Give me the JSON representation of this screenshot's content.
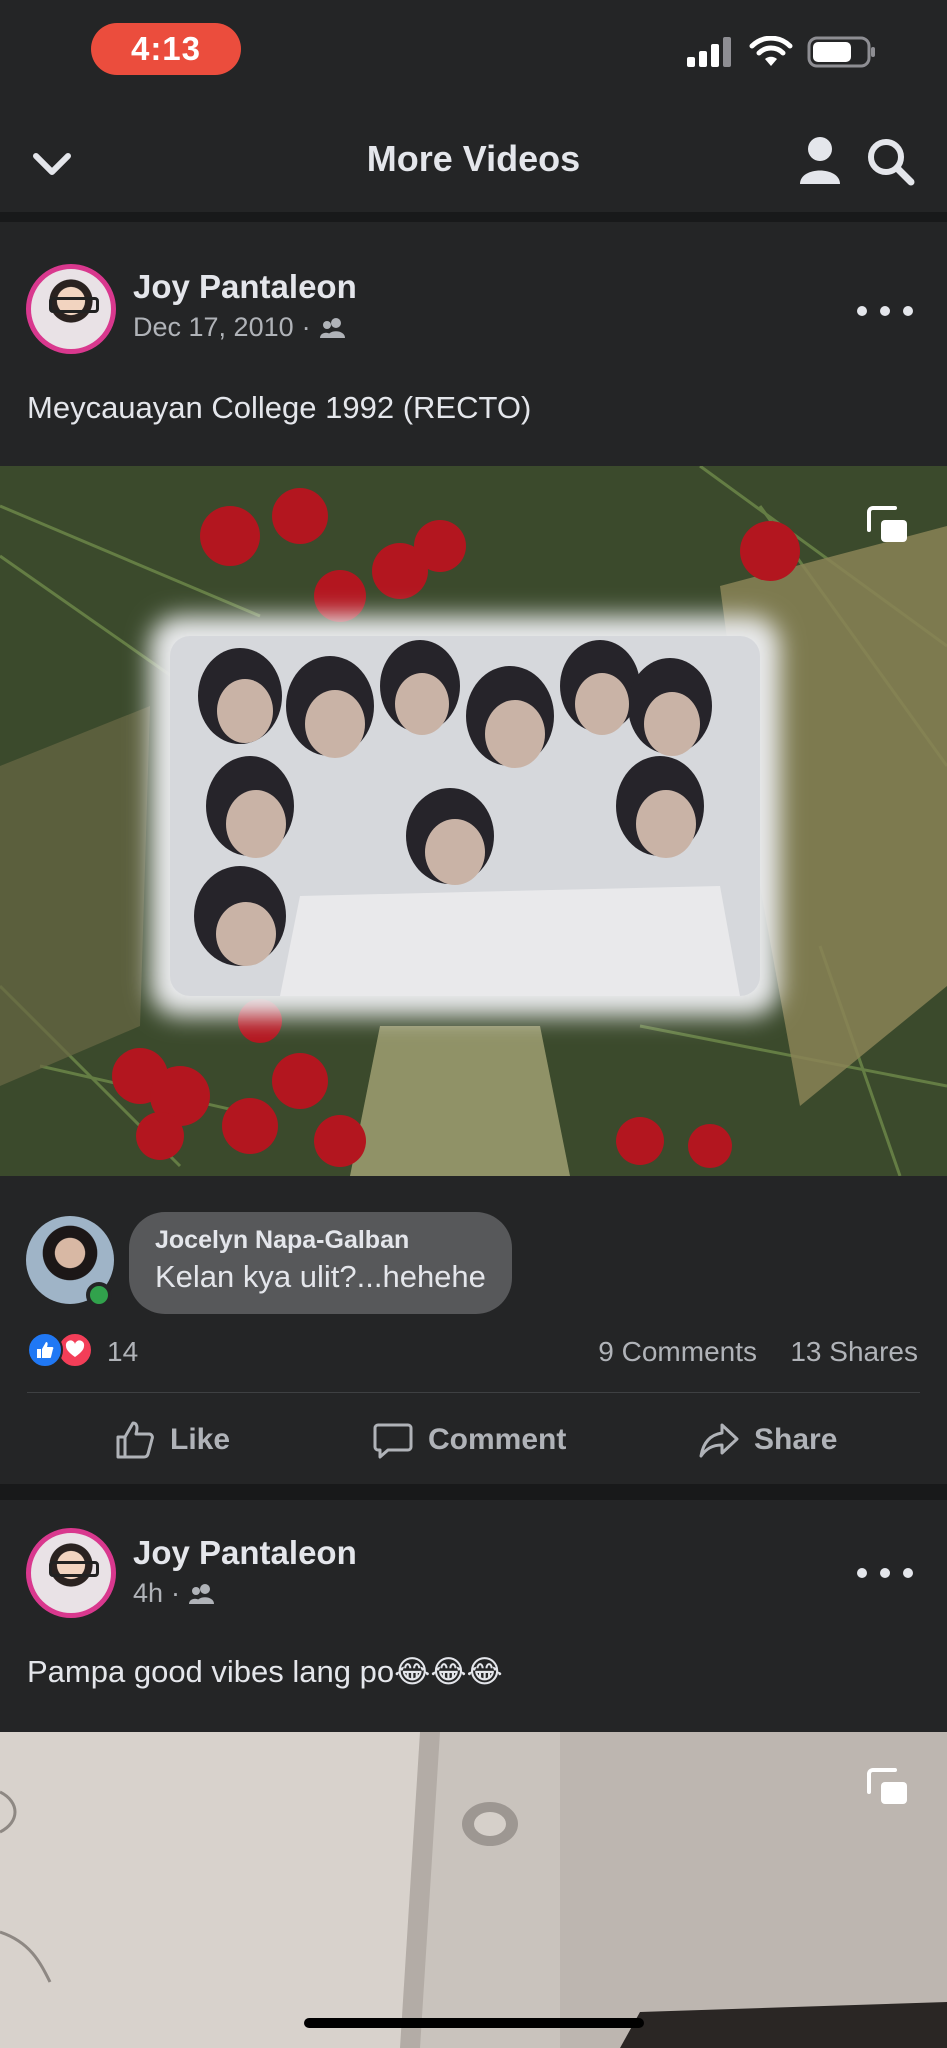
{
  "status_bar": {
    "time": "4:13"
  },
  "nav": {
    "title": "More Videos"
  },
  "posts": [
    {
      "author": "Joy Pantaleon",
      "date": "Dec 17, 2010",
      "text": "Meycauayan College 1992 (RECTO)",
      "comment": {
        "name": "Jocelyn Napa-Galban",
        "text": "Kelan kya ulit?...hehehe"
      },
      "reactions": "14",
      "comments": "9 Comments",
      "shares": "13 Shares"
    },
    {
      "author": "Joy Pantaleon",
      "date": "4h",
      "text": "Pampa good vibes lang po😂😂😂"
    }
  ],
  "actions": {
    "like": "Like",
    "comment": "Comment",
    "share": "Share"
  },
  "icons": {
    "back": "chevron-down-icon",
    "profile": "person-icon",
    "search": "search-icon",
    "audience": "friends-icon",
    "pip": "picture-in-picture-icon",
    "more": "more-dots-icon"
  },
  "colors": {
    "background": "#242526",
    "separator": "#18191a",
    "time_pill": "#eb4d3d",
    "avatar_ring": "#d9388e",
    "like_blue": "#2078f4",
    "love_red": "#f33e58",
    "online_green": "#31a24c"
  }
}
